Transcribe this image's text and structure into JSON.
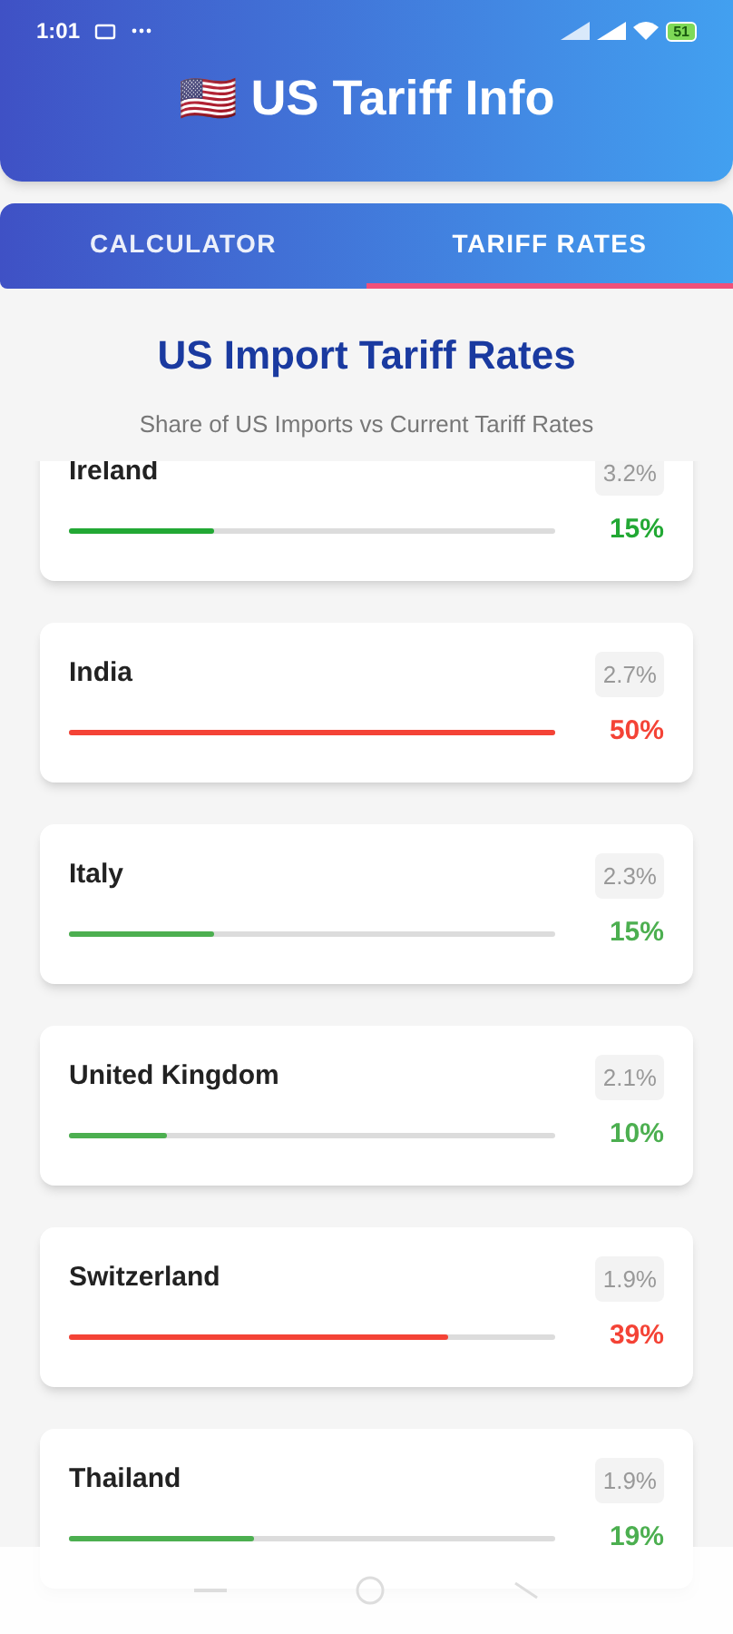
{
  "status_bar": {
    "time": "1:01",
    "battery": "51"
  },
  "header": {
    "flag": "🇺🇸",
    "title": "US Tariff Info"
  },
  "tabs": [
    {
      "label": "CALCULATOR",
      "selected": false
    },
    {
      "label": "TARIFF RATES",
      "selected": true
    }
  ],
  "heading": "US Import Tariff Rates",
  "subtitle": "Share of US Imports vs Current Tariff Rates",
  "countries": [
    {
      "name": "Ireland",
      "share": "3.2%",
      "rate": "15%",
      "level": 0.3,
      "color": "#22a834"
    },
    {
      "name": "India",
      "share": "2.7%",
      "rate": "50%",
      "level": 1,
      "color": "#f44336"
    },
    {
      "name": "Italy",
      "share": "2.3%",
      "rate": "15%",
      "level": 0.3,
      "color": "#4caf50"
    },
    {
      "name": "United Kingdom",
      "share": "2.1%",
      "rate": "10%",
      "level": 0.2,
      "color": "#4caf50"
    },
    {
      "name": "Switzerland",
      "share": "1.9%",
      "rate": "39%",
      "level": 0.78,
      "color": "#f44336"
    },
    {
      "name": "Thailand",
      "share": "1.9%",
      "rate": "19%",
      "level": 0.38,
      "color": "#4caf50"
    }
  ]
}
